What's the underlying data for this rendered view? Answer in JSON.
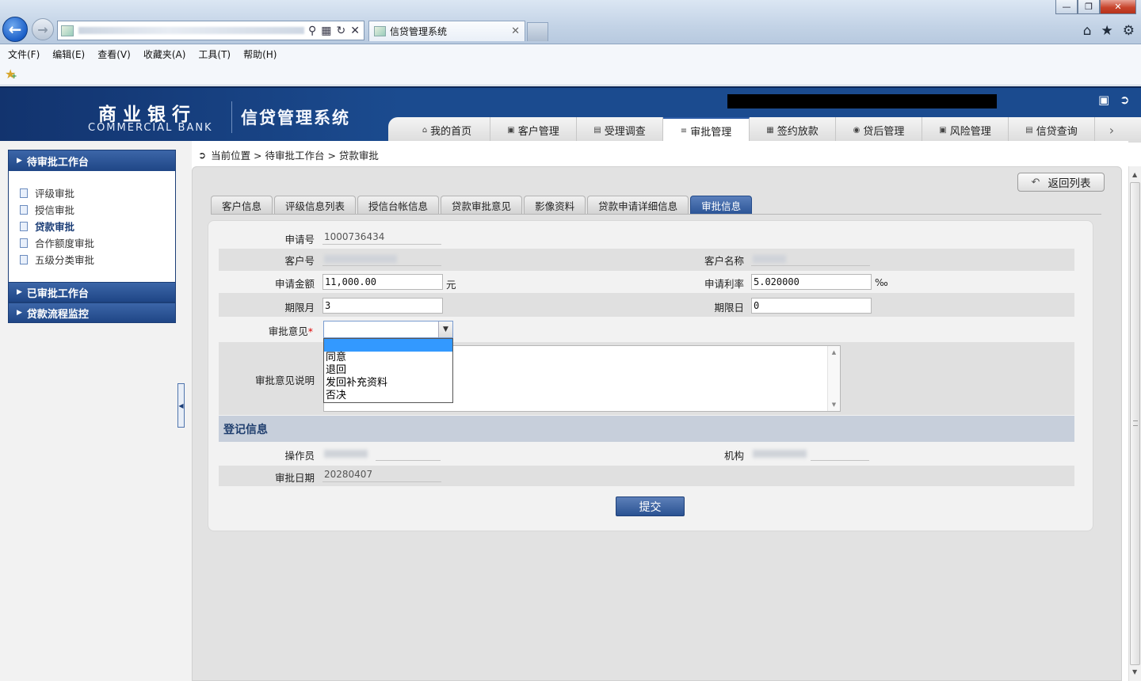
{
  "browser": {
    "tab_title": "信贷管理系统",
    "menu": [
      "文件(F)",
      "编辑(E)",
      "查看(V)",
      "收藏夹(A)",
      "工具(T)",
      "帮助(H)"
    ]
  },
  "header": {
    "logo_cn": "商业银行",
    "logo_en": "COMMERCIAL BANK",
    "system_title": "信贷管理系统",
    "nav_tabs": [
      {
        "label": "我的首页",
        "icon": "home-icon"
      },
      {
        "label": "客户管理",
        "icon": "customer-icon"
      },
      {
        "label": "受理调查",
        "icon": "survey-icon"
      },
      {
        "label": "审批管理",
        "icon": "approval-icon",
        "active": true
      },
      {
        "label": "签约放款",
        "icon": "contract-icon"
      },
      {
        "label": "贷后管理",
        "icon": "post-loan-icon"
      },
      {
        "label": "风险管理",
        "icon": "risk-icon"
      },
      {
        "label": "信贷查询",
        "icon": "query-icon"
      }
    ]
  },
  "sidebar": {
    "panel_title": "待审批工作台",
    "items": [
      "评级审批",
      "授信审批",
      "贷款审批",
      "合作额度审批",
      "五级分类审批"
    ],
    "active_item": "贷款审批",
    "collapsed": [
      "已审批工作台",
      "贷款流程监控"
    ]
  },
  "breadcrumb": {
    "text": "当前位置 > 待审批工作台 > 贷款审批"
  },
  "back_button": "返回列表",
  "tabs": [
    "客户信息",
    "评级信息列表",
    "授信台帐信息",
    "贷款审批意见",
    "影像资料",
    "贷款申请详细信息",
    "审批信息"
  ],
  "active_tab": "审批信息",
  "form": {
    "application_no_label": "申请号",
    "application_no": "1000736434",
    "customer_no_label": "客户号",
    "customer_name_label": "客户名称",
    "amount_label": "申请金额",
    "amount": "11,000.00",
    "amount_unit": "元",
    "rate_label": "申请利率",
    "rate": "5.020000",
    "rate_unit": "‰",
    "term_month_label": "期限月",
    "term_month": "3",
    "term_day_label": "期限日",
    "term_day": "0",
    "opinion_label": "审批意见",
    "opinion_required": "*",
    "opinion_options": [
      "",
      "同意",
      "退回",
      "发回补充资料",
      "否决"
    ],
    "opinion_desc_label": "审批意见说明"
  },
  "registration": {
    "section_title": "登记信息",
    "operator_label": "操作员",
    "org_label": "机构",
    "date_label": "审批日期",
    "date": "20280407"
  },
  "submit_label": "提交"
}
